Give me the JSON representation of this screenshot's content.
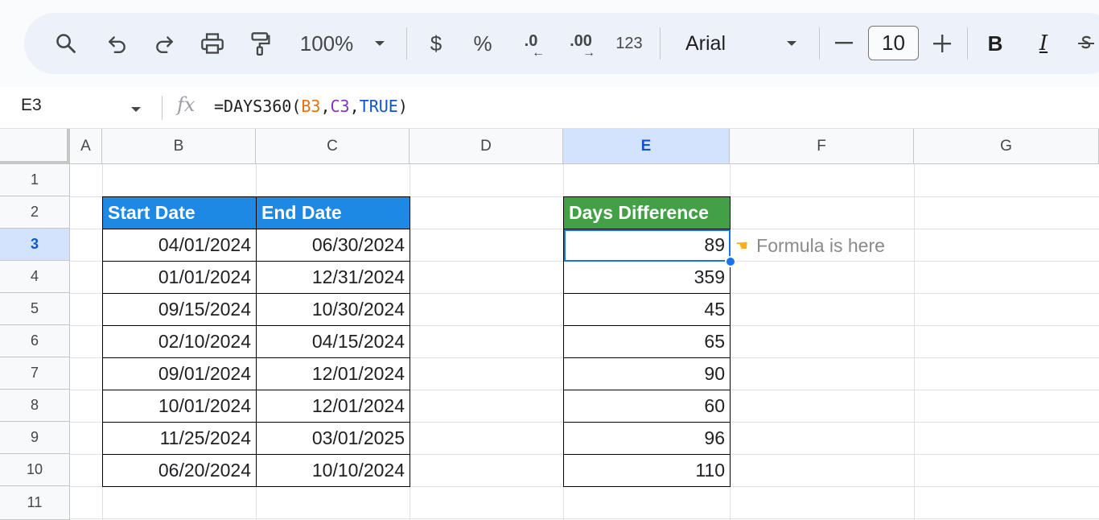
{
  "toolbar": {
    "zoom": "100%",
    "currency": "$",
    "percent": "%",
    "decrease_decimal": ".0",
    "increase_decimal": ".00",
    "number_format": "123",
    "font": "Arial",
    "font_size": "10",
    "bold": "B",
    "italic": "I",
    "icons": [
      "search-icon",
      "undo-icon",
      "redo-icon",
      "print-icon",
      "paint-format-icon",
      "chevron-down-icon",
      "minus-icon",
      "plus-icon",
      "strikethrough-icon"
    ]
  },
  "formula_bar": {
    "cell_ref": "E3",
    "fx": "fx",
    "formula_prefix": "=DAYS360(",
    "arg1": "B3",
    "comma1": ",",
    "arg2": "C3",
    "comma2": ",",
    "arg3": "TRUE",
    "formula_suffix": ")"
  },
  "columns": [
    "A",
    "B",
    "C",
    "D",
    "E",
    "F",
    "G"
  ],
  "rows": [
    "1",
    "2",
    "3",
    "4",
    "5",
    "6",
    "7",
    "8",
    "9",
    "10",
    "11"
  ],
  "active": {
    "column": "E",
    "row": "3"
  },
  "table": {
    "headers": {
      "start": "Start Date",
      "end": "End Date",
      "diff": "Days Difference"
    },
    "start_dates": [
      "04/01/2024",
      "01/01/2024",
      "09/15/2024",
      "02/10/2024",
      "09/01/2024",
      "10/01/2024",
      "11/25/2024",
      "06/20/2024"
    ],
    "end_dates": [
      "06/30/2024",
      "12/31/2024",
      "10/30/2024",
      "04/15/2024",
      "12/01/2024",
      "12/01/2024",
      "03/01/2025",
      "10/10/2024"
    ],
    "differences": [
      "89",
      "359",
      "45",
      "65",
      "90",
      "60",
      "96",
      "110"
    ]
  },
  "note": {
    "icon": "pointing-hand-icon",
    "text": "Formula is here"
  },
  "colors": {
    "header_blue": "#1e88e5",
    "header_green": "#43a047",
    "selection": "#1a73e8"
  }
}
